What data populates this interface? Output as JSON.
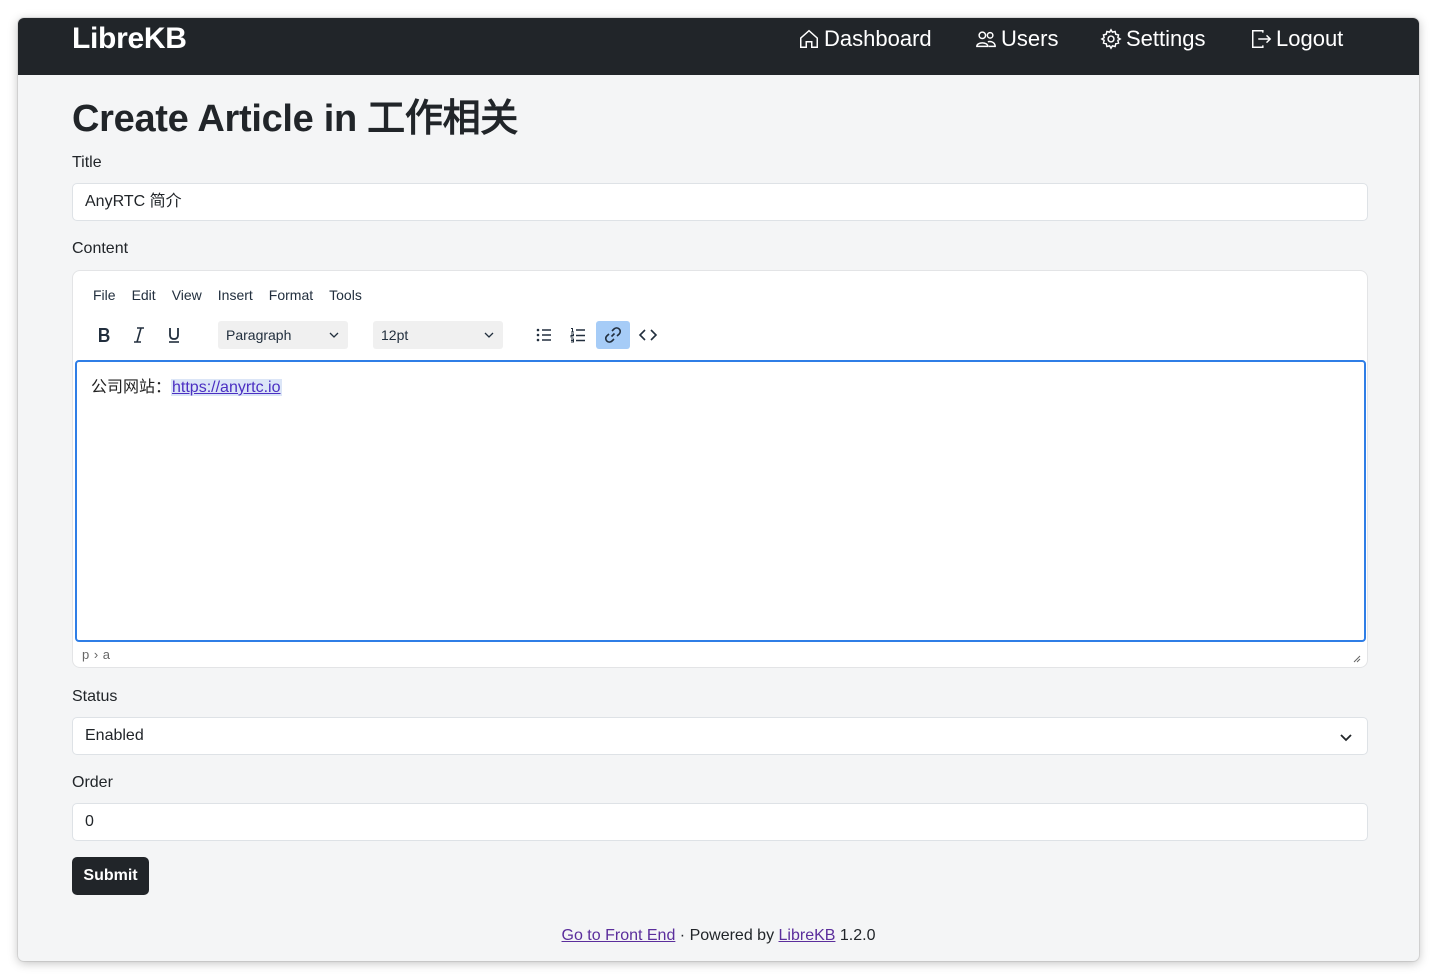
{
  "navbar": {
    "brand": "LibreKB",
    "items": [
      {
        "label": "Dashboard",
        "icon": "house-icon"
      },
      {
        "label": "Users",
        "icon": "people-icon"
      },
      {
        "label": "Settings",
        "icon": "gear-icon"
      },
      {
        "label": "Logout",
        "icon": "logout-icon"
      }
    ]
  },
  "page": {
    "title": "Create Article in 工作相关"
  },
  "form": {
    "title_label": "Title",
    "title_value": "AnyRTC 简介",
    "content_label": "Content",
    "status_label": "Status",
    "status_value": "Enabled",
    "order_label": "Order",
    "order_value": "0",
    "submit_label": "Submit"
  },
  "editor": {
    "menus": [
      "File",
      "Edit",
      "View",
      "Insert",
      "Format",
      "Tools"
    ],
    "block_format": "Paragraph",
    "font_size": "12pt",
    "toolbar_buttons": [
      "bold-icon",
      "italic-icon",
      "underline-icon",
      "bullet-list-icon",
      "numbered-list-icon",
      "link-icon",
      "code-icon"
    ],
    "active_button": "link-icon",
    "content_text": "公司网站：",
    "content_link": "https://anyrtc.io",
    "path": "p › a"
  },
  "footer": {
    "frontend_link": "Go to Front End",
    "separator": " · Powered by ",
    "brand_link": "LibreKB",
    "version": " 1.2.0"
  },
  "colors": {
    "navbar_bg": "#212529",
    "page_bg": "#f4f5f6",
    "focus_border": "#2f7ee6",
    "active_tool_bg": "#a6ccf7",
    "link_color": "#5b2e9c"
  }
}
